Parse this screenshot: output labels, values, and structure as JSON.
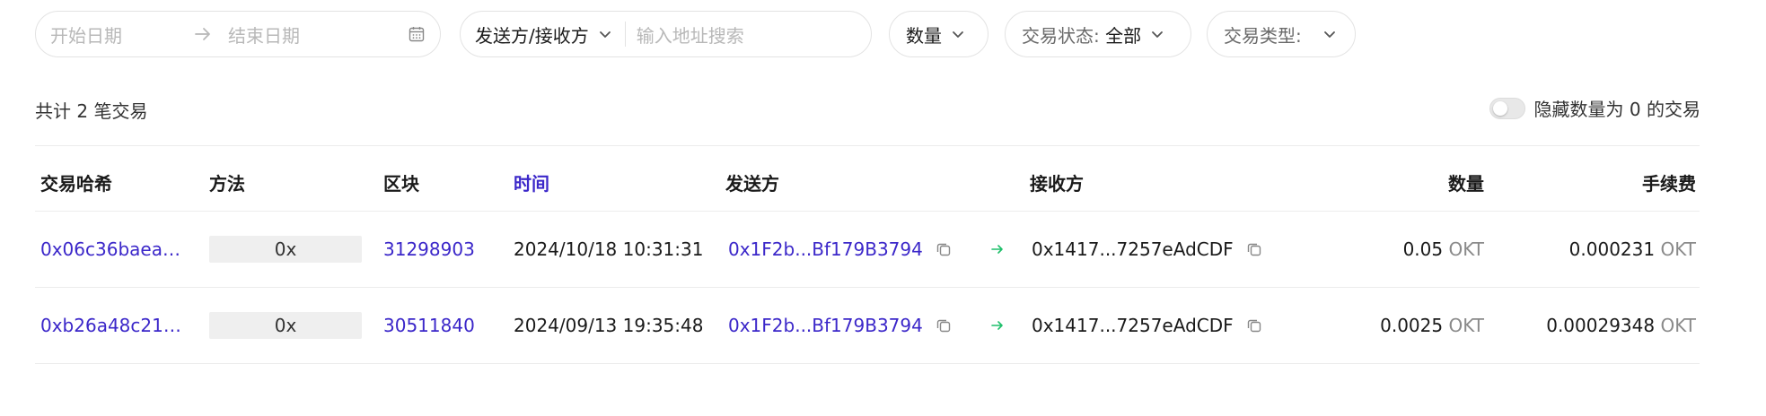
{
  "filters": {
    "date": {
      "start_placeholder": "开始日期",
      "end_placeholder": "结束日期"
    },
    "party": {
      "label": "发送方/接收方",
      "placeholder": "输入地址搜索"
    },
    "amount": {
      "label": "数量"
    },
    "status": {
      "label": "交易状态: ",
      "value": "全部"
    },
    "type": {
      "label": "交易类型: "
    }
  },
  "summary": {
    "text": "共计 2 笔交易"
  },
  "hide_zero": {
    "label": "隐藏数量为 0 的交易",
    "enabled": false
  },
  "table": {
    "headers": {
      "hash": "交易哈希",
      "method": "方法",
      "block": "区块",
      "time": "时间",
      "from": "发送方",
      "to": "接收方",
      "amount": "数量",
      "fee": "手续费"
    },
    "rows": [
      {
        "hash": "0x06c36baea…",
        "method": "0x",
        "block": "31298903",
        "time": "2024/10/18 10:31:31",
        "from": "0x1F2b...Bf179B3794",
        "to": "0x1417...7257eAdCDF",
        "amount": "0.05",
        "amount_unit": "OKT",
        "fee": "0.000231",
        "fee_unit": "OKT"
      },
      {
        "hash": "0xb26a48c21…",
        "method": "0x",
        "block": "30511840",
        "time": "2024/09/13 19:35:48",
        "from": "0x1F2b...Bf179B3794",
        "to": "0x1417...7257eAdCDF",
        "amount": "0.0025",
        "amount_unit": "OKT",
        "fee": "0.00029348",
        "fee_unit": "OKT"
      }
    ]
  },
  "colors": {
    "link": "#3b27c9",
    "arrow": "#1fbf6b",
    "border": "#e3e3e3",
    "muted": "#8a8a8a"
  },
  "icons": [
    "calendar-icon",
    "arrow-right-icon",
    "chevron-down-icon",
    "copy-icon",
    "transfer-arrow-icon"
  ]
}
